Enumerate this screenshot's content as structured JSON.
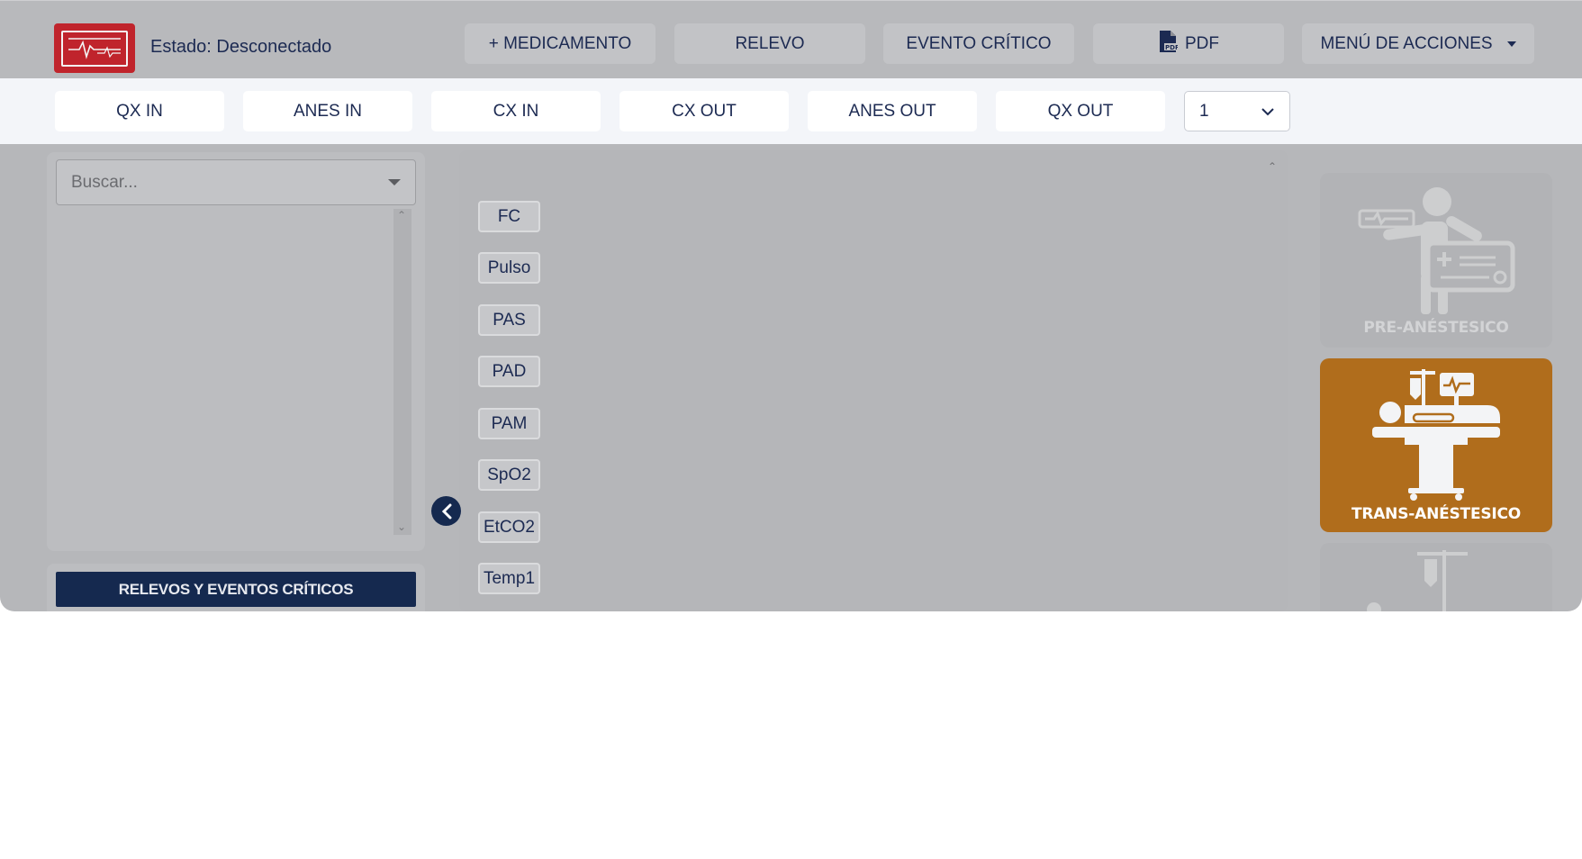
{
  "header": {
    "status_text": "Estado: Desconectado",
    "buttons": {
      "medicamento": "+ MEDICAMENTO",
      "relevo": "RELEVO",
      "evento_critico": "EVENTO CRÍTICO",
      "pdf": "PDF",
      "menu_acciones": "MENÚ DE ACCIONES"
    },
    "icons": {
      "logo": "ecg-monitor-icon",
      "pdf": "pdf-file-icon",
      "menu": "caret-down-icon"
    }
  },
  "steps": {
    "items": [
      "QX IN",
      "ANES IN",
      "CX IN",
      "CX OUT",
      "ANES OUT",
      "QX OUT"
    ],
    "selector_value": "1"
  },
  "sidebar": {
    "search_placeholder": "Buscar...",
    "relevos_button": "RELEVOS Y EVENTOS CRÍTICOS"
  },
  "vitals": {
    "labels": [
      "FC",
      "Pulso",
      "PAS",
      "PAD",
      "PAM",
      "SpO2",
      "EtCO2",
      "Temp1"
    ]
  },
  "phases": {
    "pre": "PRE-ANÉSTESICO",
    "trans": "TRANS-ANÉSTESICO",
    "active": "trans",
    "active_color": "#b06d1c",
    "inactive_color": "#b2b3b6"
  }
}
